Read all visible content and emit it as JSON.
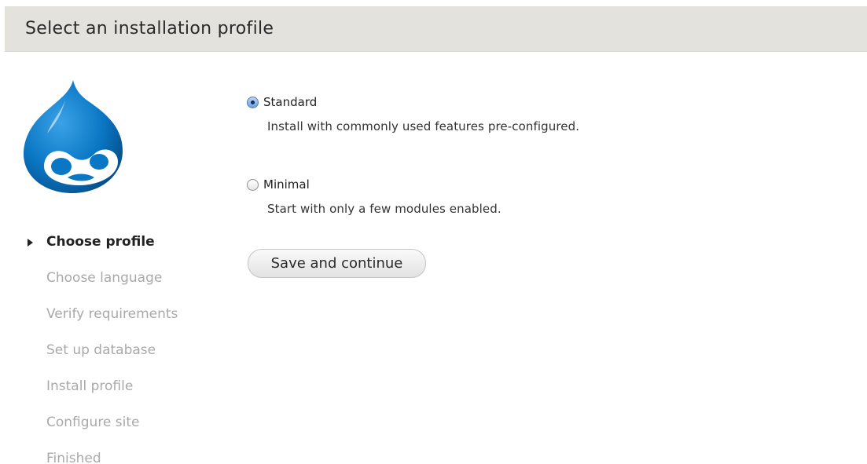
{
  "header": {
    "title": "Select an installation profile"
  },
  "logo": {
    "icon": "drupal-drop-logo",
    "color": "#0a77c4"
  },
  "steps": [
    {
      "label": "Choose profile",
      "active": true
    },
    {
      "label": "Choose language",
      "active": false
    },
    {
      "label": "Verify requirements",
      "active": false
    },
    {
      "label": "Set up database",
      "active": false
    },
    {
      "label": "Install profile",
      "active": false
    },
    {
      "label": "Configure site",
      "active": false
    },
    {
      "label": "Finished",
      "active": false
    }
  ],
  "profiles": [
    {
      "label": "Standard",
      "description": "Install with commonly used features pre-configured.",
      "selected": true
    },
    {
      "label": "Minimal",
      "description": "Start with only a few modules enabled.",
      "selected": false
    }
  ],
  "actions": {
    "save_label": "Save and continue"
  }
}
